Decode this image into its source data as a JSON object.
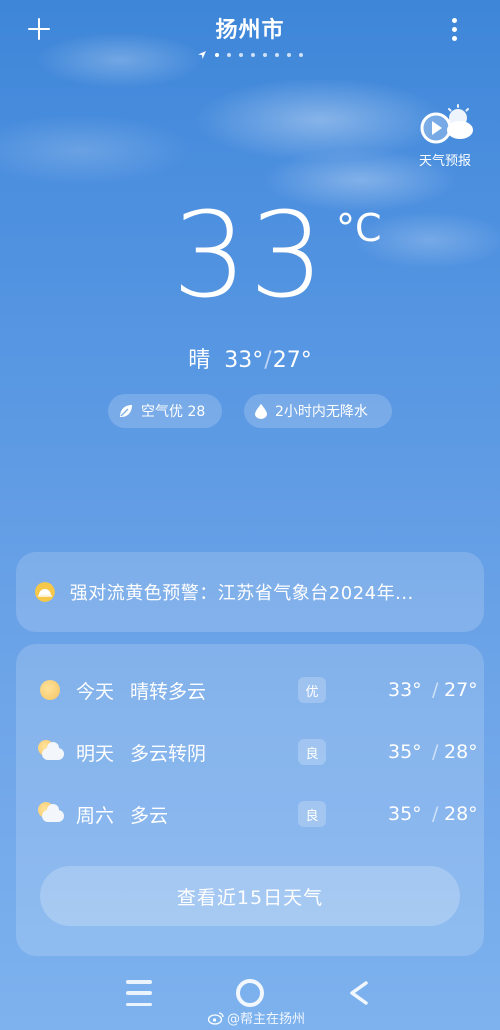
{
  "header": {
    "city": "扬州市",
    "add_icon": "plus-icon",
    "more_icon": "more-vertical-icon",
    "page_dots_count": 9,
    "active_dot_index": 0
  },
  "forecast_video": {
    "label": "天气预报",
    "icon": "play-sun-cloud-icon"
  },
  "current": {
    "temperature": "33",
    "unit": "°C",
    "condition": "晴",
    "high": "33°",
    "low": "27°",
    "separator": "/"
  },
  "pills": {
    "aqi": {
      "icon": "leaf-icon",
      "label": "空气优 28"
    },
    "rain": {
      "icon": "drop-icon",
      "label": "2小时内无降水"
    }
  },
  "alert": {
    "icon": "warning-sun-icon",
    "text": "强对流黄色预警：江苏省气象台2024年...",
    "icon_color": "#f5c84a"
  },
  "forecast": {
    "days": [
      {
        "day": "今天",
        "desc": "晴转多云",
        "aqi": "优",
        "high": "33°",
        "low": "27°",
        "icon": "sunny-icon"
      },
      {
        "day": "明天",
        "desc": "多云转阴",
        "aqi": "良",
        "high": "35°",
        "low": "28°",
        "icon": "partly-cloudy-icon"
      },
      {
        "day": "周六",
        "desc": "多云",
        "aqi": "良",
        "high": "35°",
        "low": "28°",
        "icon": "partly-cloudy-icon"
      }
    ],
    "more_button": "查看近15日天气",
    "separator": "/"
  },
  "navbar": {
    "menu_icon": "menu-icon",
    "home_icon": "home-circle-icon",
    "back_icon": "back-chevron-icon"
  },
  "watermark": "@帮主在扬州"
}
